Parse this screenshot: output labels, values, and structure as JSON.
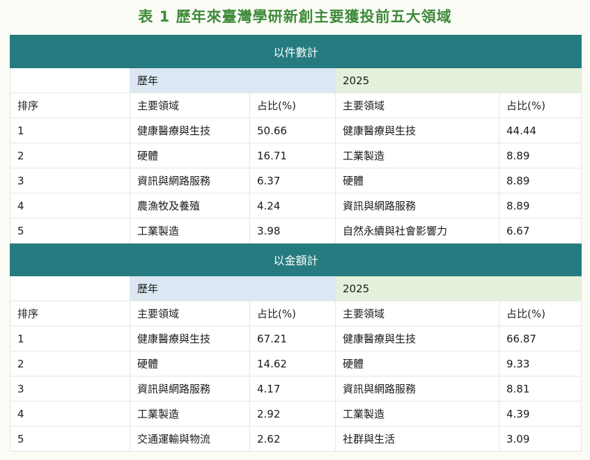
{
  "title": "表 1  歷年來臺灣學研新創主要獲投前五大領域",
  "colors": {
    "section_header": "#267b80",
    "historical": "#dbe8f3",
    "recent": "#e4f0db",
    "title": "#3e8a3a"
  },
  "sections": [
    {
      "header": "以件數計",
      "period_historical": "歷年",
      "period_recent": "2025",
      "col_rank": "排序",
      "col_field": "主要領域",
      "col_share": "占比(%)",
      "rows": [
        {
          "rank": "1",
          "hist_field": "健康醫療與生技",
          "hist_share": "50.66",
          "recent_field": "健康醫療與生技",
          "recent_share": "44.44"
        },
        {
          "rank": "2",
          "hist_field": "硬體",
          "hist_share": "16.71",
          "recent_field": "工業製造",
          "recent_share": "8.89"
        },
        {
          "rank": "3",
          "hist_field": "資訊與網路服務",
          "hist_share": "6.37",
          "recent_field": "硬體",
          "recent_share": "8.89"
        },
        {
          "rank": "4",
          "hist_field": "農漁牧及養殖",
          "hist_share": "4.24",
          "recent_field": "資訊與網路服務",
          "recent_share": "8.89"
        },
        {
          "rank": "5",
          "hist_field": "工業製造",
          "hist_share": "3.98",
          "recent_field": "自然永續與社會影響力",
          "recent_share": "6.67"
        }
      ]
    },
    {
      "header": "以金額計",
      "period_historical": "歷年",
      "period_recent": "2025",
      "col_rank": "排序",
      "col_field": "主要領域",
      "col_share": "占比(%)",
      "rows": [
        {
          "rank": "1",
          "hist_field": "健康醫療與生技",
          "hist_share": "67.21",
          "recent_field": "健康醫療與生技",
          "recent_share": "66.87"
        },
        {
          "rank": "2",
          "hist_field": "硬體",
          "hist_share": "14.62",
          "recent_field": "硬體",
          "recent_share": "9.33"
        },
        {
          "rank": "3",
          "hist_field": "資訊與網路服務",
          "hist_share": "4.17",
          "recent_field": "資訊與網路服務",
          "recent_share": "8.81"
        },
        {
          "rank": "4",
          "hist_field": "工業製造",
          "hist_share": "2.92",
          "recent_field": "工業製造",
          "recent_share": "4.39"
        },
        {
          "rank": "5",
          "hist_field": "交通運輸與物流",
          "hist_share": "2.62",
          "recent_field": "社群與生活",
          "recent_share": "3.09"
        }
      ]
    }
  ]
}
